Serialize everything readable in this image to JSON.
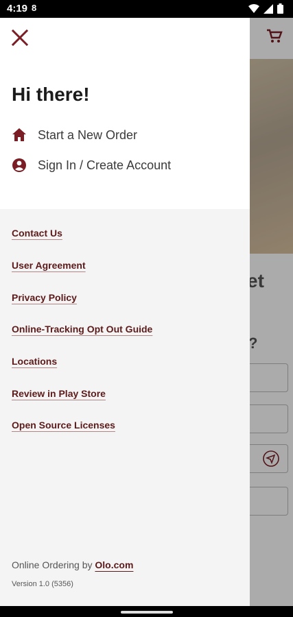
{
  "status_bar": {
    "time": "4:19",
    "sim_glyph": "8",
    "icons": [
      "wifi-icon",
      "signal-icon",
      "battery-icon"
    ]
  },
  "drawer": {
    "greeting": "Hi there!",
    "menu": [
      {
        "label": "Start a New Order",
        "icon": "home-icon"
      },
      {
        "label": "Sign In / Create Account",
        "icon": "account-circle-icon"
      }
    ],
    "links": [
      "Contact Us",
      "User Agreement",
      "Privacy Policy",
      "Online-Tracking Opt Out Guide",
      "Locations",
      "Review in Play Store",
      "Open Source Licenses"
    ],
    "footer": {
      "prefix": "Online Ordering by",
      "brand_link": "Olo.com",
      "version": "Version 1.0 (5356)"
    }
  },
  "background": {
    "title_fragment": "et",
    "question_fragment": "?"
  },
  "colors": {
    "accent": "#7a1d24",
    "link": "#5c1a1a",
    "drawer_bg": "#f4f4f4",
    "scrim": "rgba(0,0,0,0.33)"
  }
}
